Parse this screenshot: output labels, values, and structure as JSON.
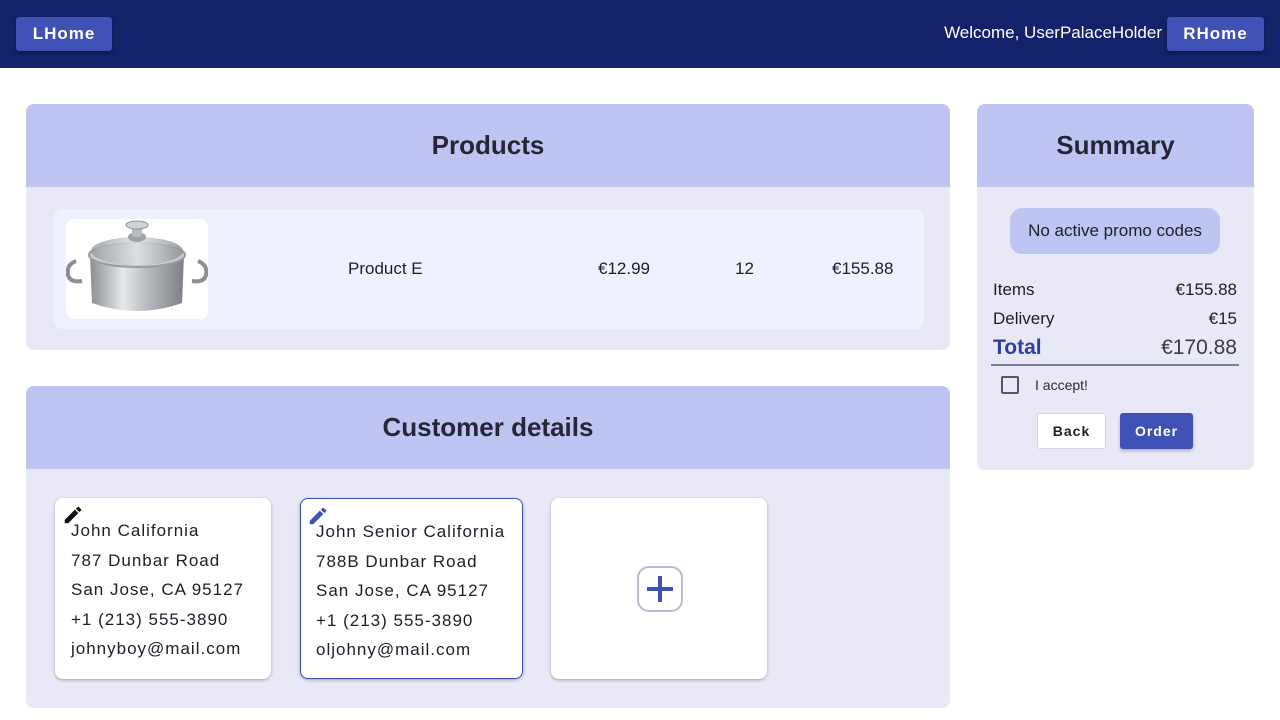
{
  "header": {
    "left_button": "LHome",
    "welcome": "Welcome, UserPalaceHolder",
    "right_button": "RHome"
  },
  "products": {
    "title": "Products",
    "items": [
      {
        "name": "Product E",
        "price": "€12.99",
        "quantity": "12",
        "total": "€155.88",
        "image": "cooking-pot"
      }
    ]
  },
  "customers": {
    "title": "Customer details",
    "cards": [
      {
        "lines": [
          "John California",
          "787 Dunbar Road",
          "San Jose, CA 95127",
          "+1 (213) 555-3890",
          "johnyboy@mail.com"
        ],
        "icon": "pencil-icon"
      },
      {
        "lines": [
          "John Senior California",
          "788B Dunbar Road",
          "San Jose, CA 95127",
          "+1 (213) 555-3890",
          "oljohny@mail.com"
        ],
        "icon": "pencil-icon",
        "selected": true
      }
    ],
    "add_icon": "plus-icon"
  },
  "summary": {
    "title": "Summary",
    "promo": "No active promo codes",
    "items_label": "Items",
    "items_value": "€155.88",
    "delivery_label": "Delivery",
    "delivery_value": "€15",
    "total_label": "Total",
    "total_value": "€170.88",
    "accept_label": "I accept!",
    "back_button": "Back",
    "order_button": "Order"
  },
  "colors": {
    "topbar": "#13226a",
    "accent": "#3f51b5",
    "panel_header": "#bfc5f2",
    "panel_body": "#e8e8f6"
  }
}
